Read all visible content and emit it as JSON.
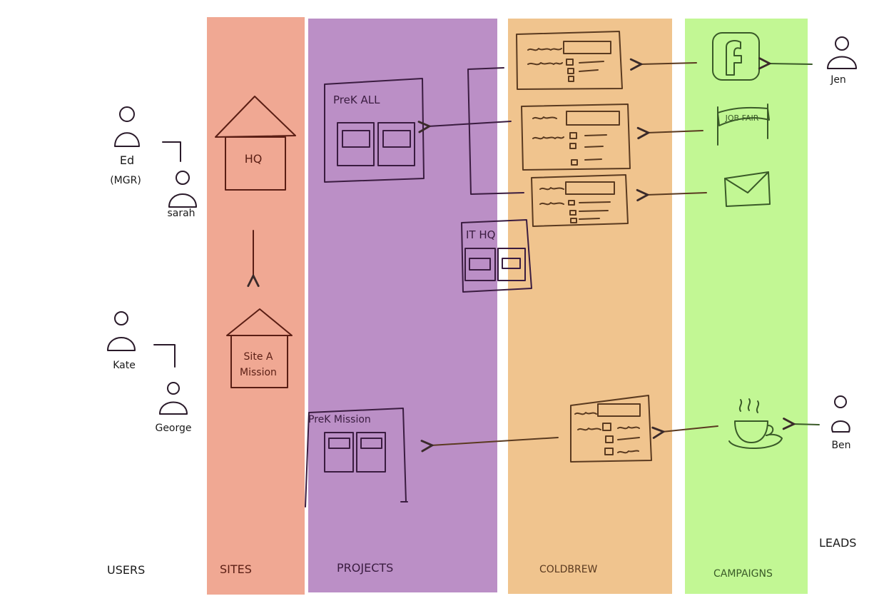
{
  "columns": {
    "users": "USERS",
    "sites": "SITES",
    "projects": "PROJECTS",
    "coldbrew": "COLDBREW",
    "campaigns": "CAMPAIGNS",
    "leads": "LEADS"
  },
  "users": {
    "ed": "Ed",
    "ed_role": "(MGR)",
    "sarah": "sarah",
    "kate": "Kate",
    "george": "George"
  },
  "sites": {
    "hq": "HQ",
    "site_a_line1": "Site A",
    "site_a_line2": "Mission"
  },
  "projects": {
    "prek_all": "PreK ALL",
    "it_hq": "IT HQ",
    "prek_mission": "PreK Mission"
  },
  "campaigns": {
    "job_fair": "JOB FAIR"
  },
  "leads": {
    "jen": "Jen",
    "ben": "Ben"
  },
  "icons": {
    "person": "person-icon",
    "house": "house-icon",
    "board": "project-board-icon",
    "form": "form-icon",
    "facebook": "facebook-icon",
    "banner": "job-fair-banner-icon",
    "email": "envelope-icon",
    "coffee": "coffee-cup-icon",
    "arrow": "arrow-icon"
  },
  "colors": {
    "sites": "#f0a893",
    "projects": "#bb8fc6",
    "coldbrew": "#f0c48e",
    "campaigns": "#c2f794"
  }
}
